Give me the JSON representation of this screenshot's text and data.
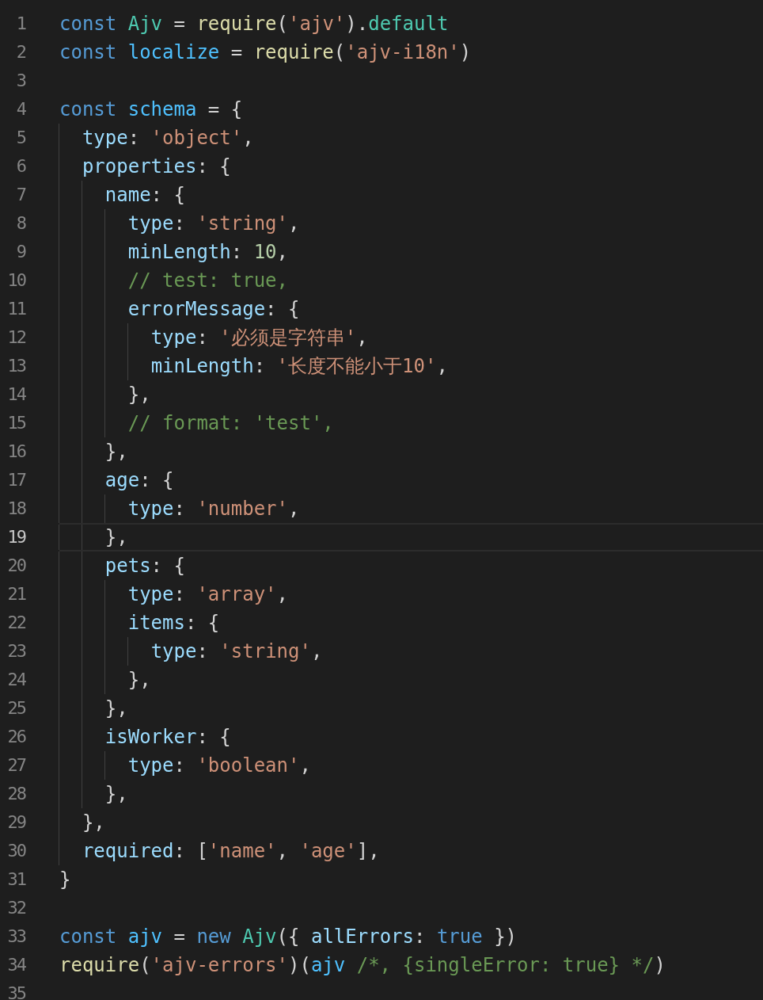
{
  "editor": {
    "lines": [
      {
        "number": "1",
        "tokens": [
          {
            "kind": "keyword",
            "text": "const "
          },
          {
            "kind": "class",
            "text": "Ajv"
          },
          {
            "kind": "punct",
            "text": " = "
          },
          {
            "kind": "function",
            "text": "require"
          },
          {
            "kind": "punct",
            "text": "("
          },
          {
            "kind": "string",
            "text": "'ajv'"
          },
          {
            "kind": "punct",
            "text": ")."
          },
          {
            "kind": "class",
            "text": "default"
          }
        ]
      },
      {
        "number": "2",
        "tokens": [
          {
            "kind": "keyword",
            "text": "const "
          },
          {
            "kind": "constant",
            "text": "localize"
          },
          {
            "kind": "punct",
            "text": " = "
          },
          {
            "kind": "function",
            "text": "require"
          },
          {
            "kind": "punct",
            "text": "("
          },
          {
            "kind": "string",
            "text": "'ajv-i18n'"
          },
          {
            "kind": "punct",
            "text": ")"
          }
        ]
      },
      {
        "number": "3"
      },
      {
        "number": "4",
        "tokens": [
          {
            "kind": "keyword",
            "text": "const "
          },
          {
            "kind": "constant",
            "text": "schema"
          },
          {
            "kind": "punct",
            "text": " = {"
          }
        ]
      },
      {
        "number": "5",
        "tokens": [
          {
            "kind": "property",
            "text": "  type"
          },
          {
            "kind": "punct",
            "text": ": "
          },
          {
            "kind": "string",
            "text": "'object'"
          },
          {
            "kind": "punct",
            "text": ","
          }
        ]
      },
      {
        "number": "6",
        "tokens": [
          {
            "kind": "property",
            "text": "  properties"
          },
          {
            "kind": "punct",
            "text": ": {"
          }
        ]
      },
      {
        "number": "7",
        "tokens": [
          {
            "kind": "property",
            "text": "    name"
          },
          {
            "kind": "punct",
            "text": ": {"
          }
        ]
      },
      {
        "number": "8",
        "tokens": [
          {
            "kind": "property",
            "text": "      type"
          },
          {
            "kind": "punct",
            "text": ": "
          },
          {
            "kind": "string",
            "text": "'string'"
          },
          {
            "kind": "punct",
            "text": ","
          }
        ]
      },
      {
        "number": "9",
        "tokens": [
          {
            "kind": "property",
            "text": "      minLength"
          },
          {
            "kind": "punct",
            "text": ": "
          },
          {
            "kind": "number",
            "text": "10"
          },
          {
            "kind": "punct",
            "text": ","
          }
        ]
      },
      {
        "number": "10",
        "tokens": [
          {
            "kind": "comment",
            "text": "      // test: true,"
          }
        ]
      },
      {
        "number": "11",
        "tokens": [
          {
            "kind": "property",
            "text": "      errorMessage"
          },
          {
            "kind": "punct",
            "text": ": {"
          }
        ]
      },
      {
        "number": "12",
        "tokens": [
          {
            "kind": "property",
            "text": "        type"
          },
          {
            "kind": "punct",
            "text": ": "
          },
          {
            "kind": "string",
            "text": "'必须是字符串'"
          },
          {
            "kind": "punct",
            "text": ","
          }
        ]
      },
      {
        "number": "13",
        "tokens": [
          {
            "kind": "property",
            "text": "        minLength"
          },
          {
            "kind": "punct",
            "text": ": "
          },
          {
            "kind": "string",
            "text": "'长度不能小于10'"
          },
          {
            "kind": "punct",
            "text": ","
          }
        ]
      },
      {
        "number": "14",
        "tokens": [
          {
            "kind": "punct",
            "text": "      },"
          }
        ]
      },
      {
        "number": "15",
        "tokens": [
          {
            "kind": "comment",
            "text": "      // format: 'test',"
          }
        ]
      },
      {
        "number": "16",
        "tokens": [
          {
            "kind": "punct",
            "text": "    },"
          }
        ]
      },
      {
        "number": "17",
        "tokens": [
          {
            "kind": "property",
            "text": "    age"
          },
          {
            "kind": "punct",
            "text": ": {"
          }
        ]
      },
      {
        "number": "18",
        "tokens": [
          {
            "kind": "property",
            "text": "      type"
          },
          {
            "kind": "punct",
            "text": ": "
          },
          {
            "kind": "string",
            "text": "'number'"
          },
          {
            "kind": "punct",
            "text": ","
          }
        ]
      },
      {
        "number": "19",
        "current": true,
        "tokens": [
          {
            "kind": "punct",
            "text": "    },"
          }
        ]
      },
      {
        "number": "20",
        "tokens": [
          {
            "kind": "property",
            "text": "    pets"
          },
          {
            "kind": "punct",
            "text": ": {"
          }
        ]
      },
      {
        "number": "21",
        "tokens": [
          {
            "kind": "property",
            "text": "      type"
          },
          {
            "kind": "punct",
            "text": ": "
          },
          {
            "kind": "string",
            "text": "'array'"
          },
          {
            "kind": "punct",
            "text": ","
          }
        ]
      },
      {
        "number": "22",
        "tokens": [
          {
            "kind": "property",
            "text": "      items"
          },
          {
            "kind": "punct",
            "text": ": {"
          }
        ]
      },
      {
        "number": "23",
        "tokens": [
          {
            "kind": "property",
            "text": "        type"
          },
          {
            "kind": "punct",
            "text": ": "
          },
          {
            "kind": "string",
            "text": "'string'"
          },
          {
            "kind": "punct",
            "text": ","
          }
        ]
      },
      {
        "number": "24",
        "tokens": [
          {
            "kind": "punct",
            "text": "      },"
          }
        ]
      },
      {
        "number": "25",
        "tokens": [
          {
            "kind": "punct",
            "text": "    },"
          }
        ]
      },
      {
        "number": "26",
        "tokens": [
          {
            "kind": "property",
            "text": "    isWorker"
          },
          {
            "kind": "punct",
            "text": ": {"
          }
        ]
      },
      {
        "number": "27",
        "tokens": [
          {
            "kind": "property",
            "text": "      type"
          },
          {
            "kind": "punct",
            "text": ": "
          },
          {
            "kind": "string",
            "text": "'boolean'"
          },
          {
            "kind": "punct",
            "text": ","
          }
        ]
      },
      {
        "number": "28",
        "tokens": [
          {
            "kind": "punct",
            "text": "    },"
          }
        ]
      },
      {
        "number": "29",
        "tokens": [
          {
            "kind": "punct",
            "text": "  },"
          }
        ]
      },
      {
        "number": "30",
        "tokens": [
          {
            "kind": "property",
            "text": "  required"
          },
          {
            "kind": "punct",
            "text": ": ["
          },
          {
            "kind": "string",
            "text": "'name'"
          },
          {
            "kind": "punct",
            "text": ", "
          },
          {
            "kind": "string",
            "text": "'age'"
          },
          {
            "kind": "punct",
            "text": "],"
          }
        ]
      },
      {
        "number": "31",
        "tokens": [
          {
            "kind": "punct",
            "text": "}"
          }
        ]
      },
      {
        "number": "32"
      },
      {
        "number": "33",
        "tokens": [
          {
            "kind": "keyword",
            "text": "const "
          },
          {
            "kind": "constant",
            "text": "ajv"
          },
          {
            "kind": "punct",
            "text": " = "
          },
          {
            "kind": "keyword",
            "text": "new "
          },
          {
            "kind": "class",
            "text": "Ajv"
          },
          {
            "kind": "punct",
            "text": "({ "
          },
          {
            "kind": "property",
            "text": "allErrors"
          },
          {
            "kind": "punct",
            "text": ": "
          },
          {
            "kind": "keyword",
            "text": "true"
          },
          {
            "kind": "punct",
            "text": " })"
          }
        ]
      },
      {
        "number": "34",
        "tokens": [
          {
            "kind": "function",
            "text": "require"
          },
          {
            "kind": "punct",
            "text": "("
          },
          {
            "kind": "string",
            "text": "'ajv-errors'"
          },
          {
            "kind": "punct",
            "text": ")("
          },
          {
            "kind": "constant",
            "text": "ajv "
          },
          {
            "kind": "comment",
            "text": "/*, {singleError: true} */"
          },
          {
            "kind": "punct",
            "text": ")"
          }
        ]
      },
      {
        "number": "35"
      }
    ]
  }
}
